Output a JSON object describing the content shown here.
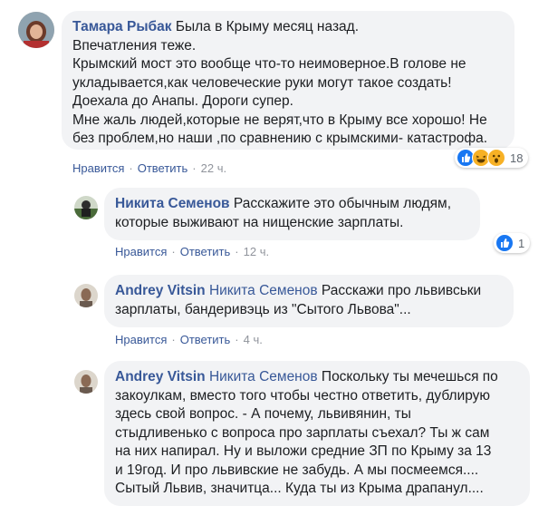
{
  "colors": {
    "author": "#385898",
    "bubble_bg": "#f2f3f5",
    "like": "#1877f2",
    "emoji_yellow": "#f7b125",
    "meta_grey": "#90949c"
  },
  "comments": [
    {
      "author": "Тамара Рыбак",
      "lines": [
        "Была в Крыму месяц назад.",
        "Впечатления теже.",
        "Крымский мост это вообще что-то неимоверное.В голове не",
        "укладывается,как человеческие руки могут такое создать!",
        "Доехала до Анапы. Дороги супер.",
        "Мне жаль людей,которые не верят,что в Крыму все хорошо! Не",
        "без проблем,но наши ,по сравнению с крымскими- катастрофа."
      ],
      "actions": {
        "like": "Нравится",
        "reply": "Ответить",
        "time": "22 ч."
      },
      "reactions": {
        "icons": [
          "like-icon",
          "haha-icon",
          "wow-icon"
        ],
        "count": "18"
      }
    },
    {
      "author": "Никита Семенов",
      "lines": [
        "Расскажите это обычным людям,",
        "которые выживают на нищенские зарплаты."
      ],
      "actions": {
        "like": "Нравится",
        "reply": "Ответить",
        "time": "12 ч."
      },
      "reactions": {
        "icons": [
          "like-icon"
        ],
        "count": "1"
      }
    },
    {
      "author": "Andrey Vitsin",
      "mention": "Никита Семенов",
      "lines": [
        "Расскажи про львивськи",
        "зарплаты, бандеривэць из \"Сытого Львова\"..."
      ],
      "actions": {
        "like": "Нравится",
        "reply": "Ответить",
        "time": "4 ч."
      }
    },
    {
      "author": "Andrey Vitsin",
      "mention": "Никита Семенов",
      "lines": [
        "Поскольку ты мечешься по",
        "закоулкам, вместо того чтобы честно ответить, дублирую",
        "здесь свой вопрос. - А почему, львивянин, ты",
        "стыдливенько с вопроса про зарплаты съехал? Ты ж сам",
        "на них напирал. Ну и выложи средние ЗП по Крыму за 13",
        "и 19год. И про львивские не забудь. А мы посмеемся....",
        "Сытый Львив, значитца... Куда ты из Крыма драпанул...."
      ]
    }
  ]
}
